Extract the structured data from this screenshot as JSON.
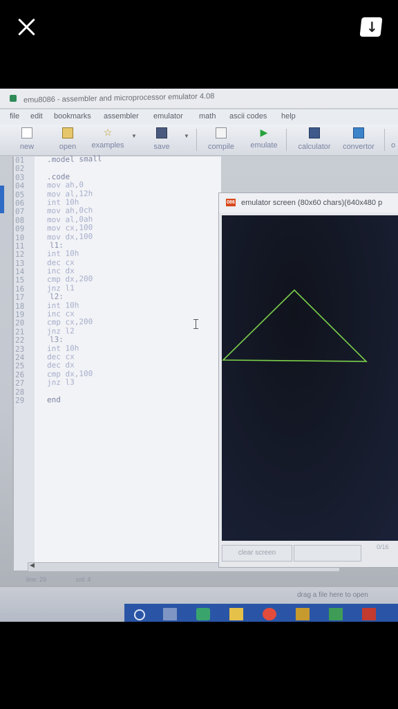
{
  "viewer": {
    "close_icon": "close-icon",
    "save_icon": "download-card-icon"
  },
  "window": {
    "title": "emu8086 - assembler and microprocessor emulator 4.08"
  },
  "menu": [
    "file",
    "edit",
    "bookmarks",
    "assembler",
    "emulator",
    "math",
    "ascii codes",
    "help"
  ],
  "toolbar": {
    "new": "new",
    "open": "open",
    "examples": "examples",
    "save": "save",
    "compile": "compile",
    "emulate": "emulate",
    "calculator": "calculator",
    "convertor": "convertor",
    "overflow": "o"
  },
  "code": [
    {
      "n": "01",
      "t": ".model small"
    },
    {
      "n": "02",
      "t": ""
    },
    {
      "n": "03",
      "t": ".code"
    },
    {
      "n": "04",
      "t": "mov ah,0"
    },
    {
      "n": "05",
      "t": "mov al,12h"
    },
    {
      "n": "06",
      "t": "int 10h"
    },
    {
      "n": "07",
      "t": "mov ah,0ch"
    },
    {
      "n": "08",
      "t": "mov al,0ah"
    },
    {
      "n": "09",
      "t": "mov cx,100"
    },
    {
      "n": "10",
      "t": "mov dx,100"
    },
    {
      "n": "11",
      "t": "l1:"
    },
    {
      "n": "12",
      "t": "int 10h"
    },
    {
      "n": "13",
      "t": "dec cx"
    },
    {
      "n": "14",
      "t": "inc dx"
    },
    {
      "n": "15",
      "t": "cmp dx,200"
    },
    {
      "n": "16",
      "t": "jnz l1"
    },
    {
      "n": "17",
      "t": "l2:"
    },
    {
      "n": "18",
      "t": "int 10h"
    },
    {
      "n": "19",
      "t": "inc cx"
    },
    {
      "n": "20",
      "t": "cmp cx,200"
    },
    {
      "n": "21",
      "t": "jnz l2"
    },
    {
      "n": "22",
      "t": "l3:"
    },
    {
      "n": "23",
      "t": "int 10h"
    },
    {
      "n": "24",
      "t": "dec cx"
    },
    {
      "n": "25",
      "t": "dec dx"
    },
    {
      "n": "26",
      "t": "cmp dx,100"
    },
    {
      "n": "27",
      "t": "jnz l3"
    },
    {
      "n": "28",
      "t": ""
    },
    {
      "n": "29",
      "t": "end"
    }
  ],
  "status": {
    "line": "line: 29",
    "col": "col: 4",
    "drag_hint": "drag a file here to open"
  },
  "emulator": {
    "title": "emulator screen (80x60 chars)(640x480 p",
    "clear_screen": "clear screen",
    "counter": "0/16",
    "triangle_color": "#7cd14a"
  }
}
